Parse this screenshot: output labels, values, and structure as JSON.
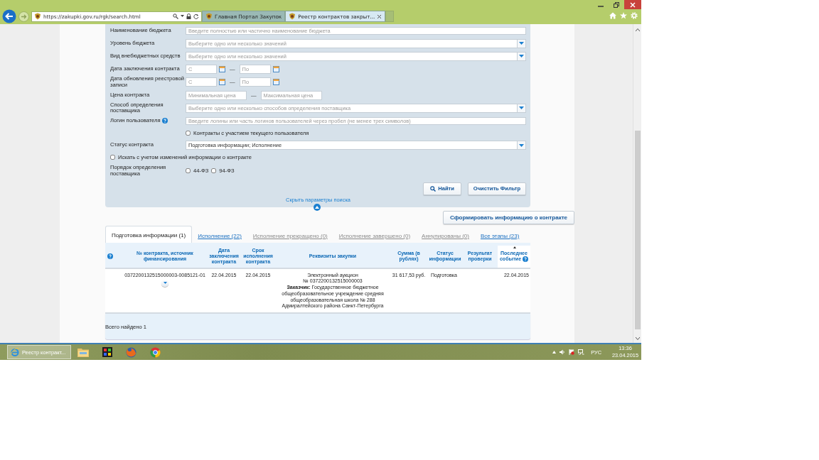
{
  "browser": {
    "address": "https://zakupki.gov.ru/rgk/search.html",
    "tabs": [
      {
        "title": "Главная Портал Закупок",
        "selected": false
      },
      {
        "title": "Реестр контрактов закрыт...",
        "selected": true
      }
    ]
  },
  "search_form": {
    "fields": [
      {
        "kind": "text",
        "label": "Наименование бюджета",
        "placeholder": "Введите полностью или частично наименование бюджета"
      },
      {
        "kind": "select",
        "label": "Уровень бюджета",
        "placeholder": "Выберите одно или несколько значений"
      },
      {
        "kind": "select",
        "label": "Вид внебюджетных средств",
        "placeholder": "Выберите одно или несколько значений"
      },
      {
        "kind": "daterange",
        "label": "Дата заключения контракта",
        "from_placeholder": "С",
        "separator": "—",
        "to_placeholder": "По"
      },
      {
        "kind": "daterange",
        "label": "Дата обновления реестровой записи",
        "from_placeholder": "С",
        "separator": "—",
        "to_placeholder": "По"
      },
      {
        "kind": "range",
        "label": "Цена контракта",
        "from_placeholder": "Минимальная цена",
        "separator": "—",
        "to_placeholder": "Максимальная цена"
      },
      {
        "kind": "select",
        "label": "Способ определения поставщика",
        "placeholder": "Выберите одно или несколько способов определения поставщика"
      },
      {
        "kind": "text",
        "label": "Логин пользователя",
        "help": true,
        "placeholder": "Введите логины или часть логинов пользователей через пробел (не менее трех символов)"
      },
      {
        "kind": "option",
        "label": "Контракты с участием текущего пользователя",
        "checked": false
      },
      {
        "kind": "select",
        "label": "Статус контракта",
        "value": "Подготовка информации; Исполнение"
      },
      {
        "kind": "checkbox",
        "label": "Искать с учетом изменений информации о контракте",
        "checked": false
      },
      {
        "kind": "checkgroup",
        "label": "Порядок определения поставщика",
        "options": [
          {
            "label": "44-ФЗ",
            "checked": false
          },
          {
            "label": "94-ФЗ",
            "checked": false
          }
        ]
      }
    ],
    "search_button": "Найти",
    "clear_button": "Очистить Фильтр",
    "hide_link": "Скрыть параметры поиска"
  },
  "generate_button": "Сформировать информацию о контракте",
  "result_tabs": [
    {
      "label": "Подготовка информации (1)",
      "selected": true,
      "disabled": false
    },
    {
      "label": "Исполнение (22)",
      "selected": false,
      "disabled": false
    },
    {
      "label": "Исполнение прекращено (0)",
      "selected": false,
      "disabled": true
    },
    {
      "label": "Исполнение завершено (0)",
      "selected": false,
      "disabled": true
    },
    {
      "label": "Аннулированы (0)",
      "selected": false,
      "disabled": true
    },
    {
      "label": "Все этапы (23)",
      "selected": false,
      "disabled": false
    }
  ],
  "table": {
    "columns": [
      {
        "label": "№ контракта, источник финансирования",
        "sorted": false
      },
      {
        "label": "Дата заключения контракта",
        "sorted": false
      },
      {
        "label": "Срок исполнения контракта",
        "sorted": false
      },
      {
        "label": "Реквизиты закупки",
        "sorted": false
      },
      {
        "label": "Сумма (в рублях)",
        "sorted": false
      },
      {
        "label": "Статус информации",
        "sorted": false
      },
      {
        "label": "Результат проверки",
        "sorted": false
      },
      {
        "label": "Последнее событие",
        "sorted": true
      }
    ],
    "rows": [
      {
        "cells": [
          "0372200132515000003-0085121-01",
          "22.04.2015",
          "22.04.2015",
          "Электронный аукцион\n№ 0372200132515000003\n**Заказчик:** Государственное бюджетное общеобразовательное учреждение средняя общеобразовательная школа № 288 Адмиралтейского района Санкт-Петербурга",
          "31 617,53 руб.",
          "Подготовка",
          "",
          "22.04.2015"
        ]
      }
    ],
    "total": "Всего найдено 1"
  },
  "taskbar": {
    "task": "Реестр контракт...",
    "language": "РУС",
    "time": "13:36",
    "date": "23.04.2015"
  }
}
